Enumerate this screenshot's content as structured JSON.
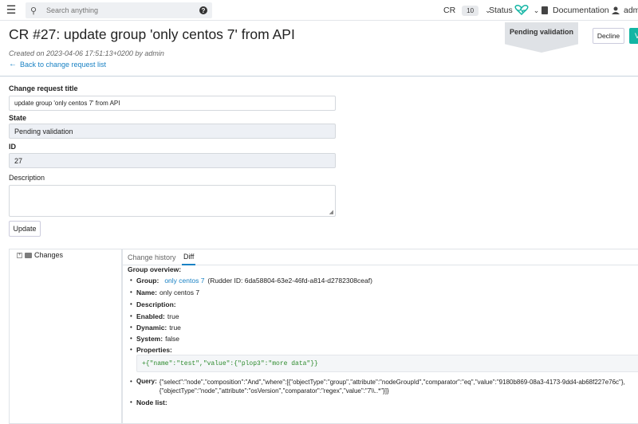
{
  "topbar": {
    "search_placeholder": "Search anything",
    "cr_label": "CR",
    "cr_count": "10",
    "status_label": "Status",
    "documentation_label": "Documentation",
    "user_label": "admi"
  },
  "header": {
    "title": "CR #27: update group 'only centos 7' from API",
    "created": "Created on 2023-04-06 17:51:13+0200 by admin",
    "back_link": "Back to change request list",
    "status_tag": "Pending validation",
    "decline_label": "Decline",
    "validate_label": "V"
  },
  "form": {
    "title_label": "Change request title",
    "title_value": "update group 'only centos 7' from API",
    "state_label": "State",
    "state_value": "Pending validation",
    "id_label": "ID",
    "id_value": "27",
    "description_label": "Description",
    "update_label": "Update"
  },
  "tree": {
    "root_label": "Changes"
  },
  "tabs": [
    {
      "label": "Change history"
    },
    {
      "label": "Diff"
    }
  ],
  "overview": {
    "title": "Group overview:",
    "group_label": "Group:",
    "group_link": "only centos 7",
    "group_rudder_id": "(Rudder ID: 6da58804-63e2-46fd-a814-d2782308ceaf)",
    "name_label": "Name:",
    "name_value": "only centos 7",
    "description_label": "Description:",
    "enabled_label": "Enabled:",
    "enabled_value": "true",
    "dynamic_label": "Dynamic:",
    "dynamic_value": "true",
    "system_label": "System:",
    "system_value": "false",
    "properties_label": "Properties:",
    "properties_code": "+{\"name\":\"test\",\"value\":{\"plop3\":\"more data\"}}",
    "query_label": "Query:",
    "query_line1": "{\"select\":\"node\",\"composition\":\"And\",\"where\":[{\"objectType\":\"group\",\"attribute\":\"nodeGroupId\",\"comparator\":\"eq\",\"value\":\"9180b869-08a3-4173-9dd4-ab68f227e76c\"},",
    "query_line2": "{\"objectType\":\"node\",\"attribute\":\"osVersion\",\"comparator\":\"regex\",\"value\":\"7\\\\..*\"}]}",
    "node_list_label": "Node list:"
  },
  "colors": {
    "accent": "#1a82c4",
    "validate": "#13b5a4",
    "status_heart": "#13b5a4"
  }
}
